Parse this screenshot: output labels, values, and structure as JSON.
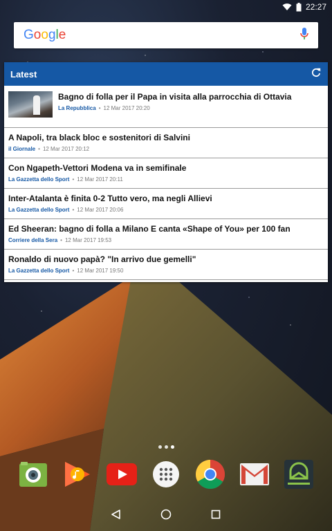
{
  "status_bar": {
    "time": "22:27",
    "icons": [
      "wifi-icon",
      "battery-icon"
    ]
  },
  "search": {
    "logo_text": "Google",
    "icons": [
      "mic-icon"
    ]
  },
  "widget": {
    "title": "Latest",
    "refresh_icon": "refresh-icon",
    "accent_color": "#1558a5",
    "items": [
      {
        "title": "Bagno di folla per il Papa in visita alla parrocchia di Ottavia",
        "source": "La Repubblica",
        "time": "12 Mar 2017 20:20",
        "has_thumbnail": true
      },
      {
        "title": "A Napoli, tra black bloc e sostenitori di Salvini",
        "source": "il Giornale",
        "time": "12 Mar 2017 20:12"
      },
      {
        "title": "Con Ngapeth-Vettori Modena va in semifinale",
        "source": "La Gazzetta dello Sport",
        "time": "12 Mar 2017 20:11"
      },
      {
        "title": "Inter-Atalanta è finita 0-2 Tutto vero, ma negli Allievi",
        "source": "La Gazzetta dello Sport",
        "time": "12 Mar 2017 20:06"
      },
      {
        "title": "Ed Sheeran: bagno di folla a Milano  E canta «Shape of You» per 100 fan",
        "source": "Corriere della Sera",
        "time": "12 Mar 2017 19:53"
      },
      {
        "title": "Ronaldo di nuovo papà? \"In arrivo due gemelli\"",
        "source": "La Gazzetta dello Sport",
        "time": "12 Mar 2017 19:50"
      }
    ]
  },
  "dock": {
    "apps": [
      "camera-app-icon",
      "play-music-icon",
      "youtube-icon",
      "app-drawer-icon",
      "chrome-icon",
      "gmail-icon",
      "android-app-icon"
    ]
  },
  "navbar": {
    "icons": [
      "back-icon",
      "home-icon",
      "recents-icon"
    ]
  }
}
